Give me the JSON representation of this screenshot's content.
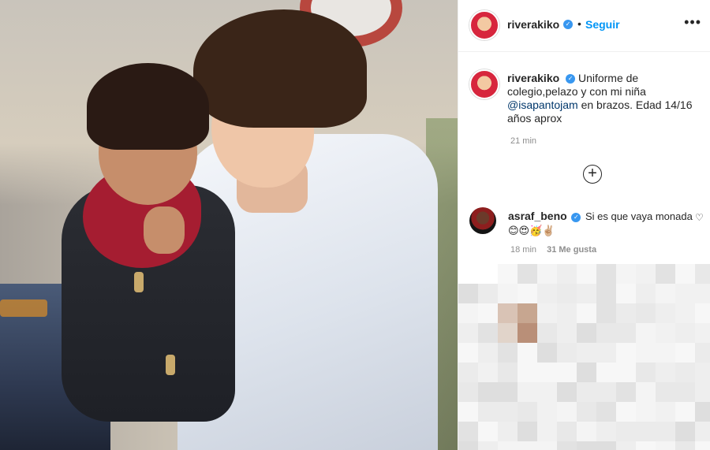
{
  "post": {
    "author": {
      "username": "riverakiko",
      "verified_glyph": "✓",
      "follow_label": "Seguir",
      "separator": "•"
    },
    "more_glyph": "•••",
    "caption": {
      "username": "riverakiko",
      "text_before": "Uniforme de colegio,pelazo y con mi niña ",
      "mention": "@isapantojam",
      "text_after": " en brazos. Edad 14/16 años aprox",
      "time": "21 min"
    },
    "load_more_glyph": "+",
    "comments": [
      {
        "username": "asraf_beno",
        "text": "Si es que vaya monada 😊😍🥳✌🏼",
        "time": "18 min",
        "likes": "31 Me gusta",
        "like_glyph": "♡"
      }
    ]
  },
  "colors": {
    "link_blue": "#0095f6",
    "verified_blue": "#3897f0",
    "mention_blue": "#00376b",
    "meta_gray": "#8e8e8e"
  },
  "icons": [
    "verified-badge-icon",
    "more-options-icon",
    "load-more-comments-icon",
    "heart-icon"
  ]
}
